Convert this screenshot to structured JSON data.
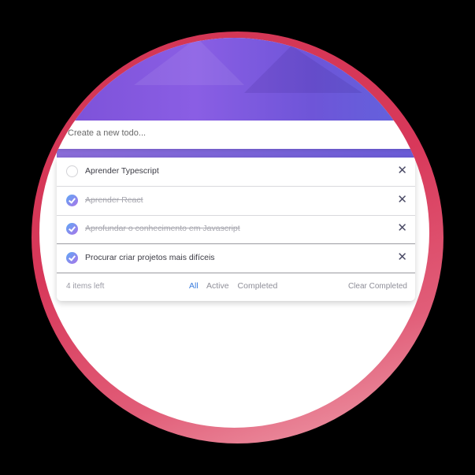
{
  "new_todo": {
    "placeholder": "Create a new todo..."
  },
  "todos": [
    {
      "text": "Aprender Typescript",
      "completed": false
    },
    {
      "text": "Aprender React",
      "completed": true
    },
    {
      "text": "Aprofundar o conhecimento em Javascript",
      "completed": true
    },
    {
      "text": "Procurar criar projetos mais difíceis",
      "completed": true
    }
  ],
  "icons": {
    "check": "check-icon",
    "delete": "close-x-icon"
  },
  "footer": {
    "items_left": "4 items left",
    "filters": [
      "All",
      "Active",
      "Completed"
    ],
    "active_filter": "All",
    "clear_label": "Clear Completed"
  },
  "colors": {
    "banner": "#7a4fd6",
    "accent": "#3b7ddd",
    "ring": "#d23653",
    "check_gradient_start": "#5ea8f5",
    "check_gradient_end": "#a974e8"
  }
}
